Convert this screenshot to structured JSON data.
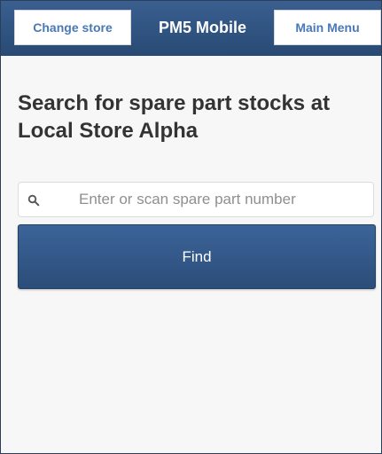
{
  "header": {
    "change_store_label": "Change store",
    "title": "PM5 Mobile",
    "main_menu_label": "Main Menu"
  },
  "main": {
    "heading": "Search for spare part stocks at Local Store Alpha",
    "search": {
      "icon": "search-icon",
      "placeholder": "Enter or scan spare part number",
      "value": ""
    },
    "find_label": "Find"
  },
  "colors": {
    "header_bg": "#2f5583",
    "button_text": "#4a79b3",
    "find_bg": "#33598a"
  }
}
